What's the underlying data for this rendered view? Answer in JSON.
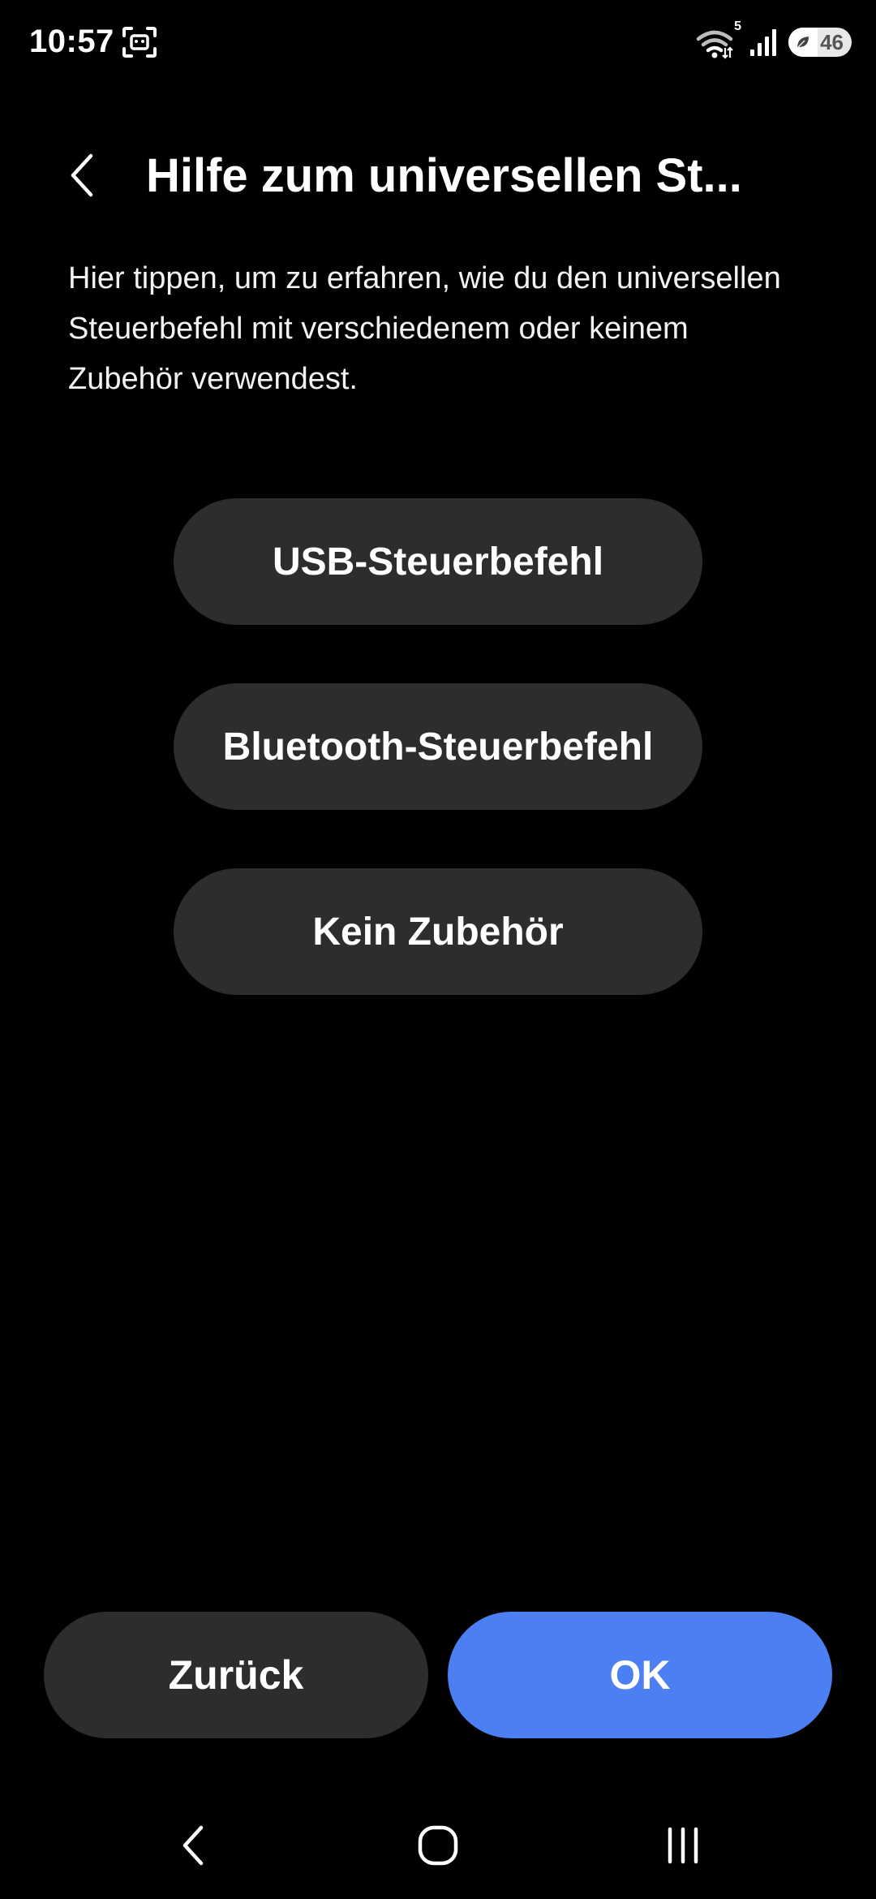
{
  "status_bar": {
    "time": "10:57",
    "wifi_badge": "5",
    "battery_level": "46",
    "icons": [
      "screenshot-icon",
      "wifi-icon",
      "signal-icon",
      "battery-icon",
      "power-saving-leaf-icon"
    ]
  },
  "header": {
    "title": "Hilfe zum universellen St...",
    "back_icon": "chevron-left-icon"
  },
  "description": "Hier tippen, um zu erfahren, wie du den universellen Steuerbefehl mit verschiedenem oder keinem Zubehör verwendest.",
  "options": [
    {
      "label": "USB-Steuerbefehl"
    },
    {
      "label": "Bluetooth-Steuerbefehl"
    },
    {
      "label": "Kein Zubehör"
    }
  ],
  "footer": {
    "back_label": "Zurück",
    "ok_label": "OK"
  },
  "navigation": {
    "icons": [
      "nav-back-icon",
      "nav-home-icon",
      "nav-recents-icon"
    ]
  },
  "colors": {
    "background": "#000000",
    "button": "#2d2d2f",
    "accent": "#4c7ff2",
    "text": "#ffffff"
  }
}
